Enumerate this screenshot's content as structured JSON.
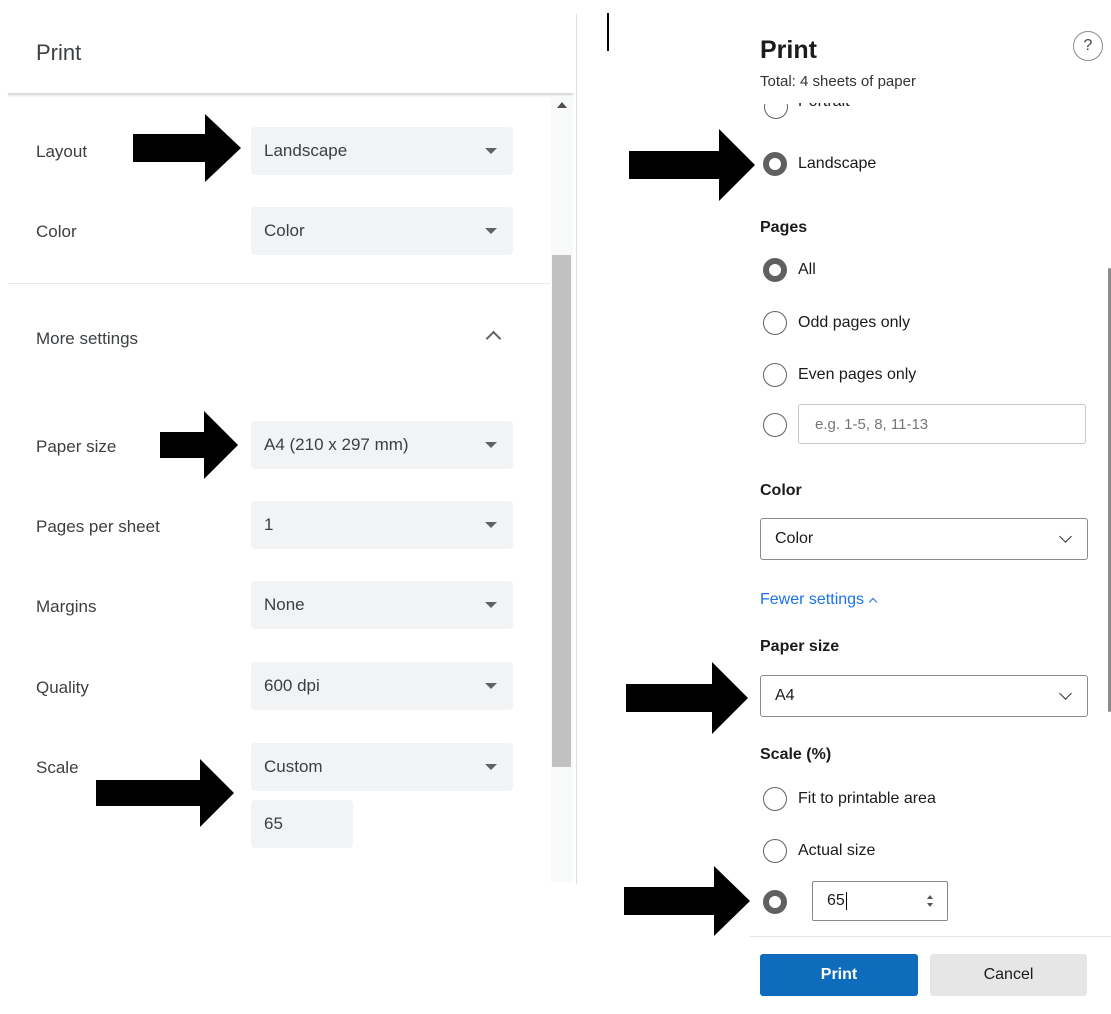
{
  "chrome_dialog": {
    "title": "Print",
    "layout": {
      "label": "Layout",
      "value": "Landscape"
    },
    "color": {
      "label": "Color",
      "value": "Color"
    },
    "more_settings": {
      "label": "More settings"
    },
    "paper_size": {
      "label": "Paper size",
      "value": "A4 (210 x 297 mm)"
    },
    "pages_per_sheet": {
      "label": "Pages per sheet",
      "value": "1"
    },
    "margins": {
      "label": "Margins",
      "value": "None"
    },
    "quality": {
      "label": "Quality",
      "value": "600 dpi"
    },
    "scale": {
      "label": "Scale",
      "value": "Custom",
      "custom_value": "65"
    }
  },
  "edge_dialog": {
    "title": "Print",
    "subtitle": "Total: 4 sheets of paper",
    "help": "?",
    "layout_options": {
      "portrait": "Portrait",
      "landscape": "Landscape",
      "selected": "landscape"
    },
    "pages": {
      "label": "Pages",
      "all": "All",
      "odd": "Odd pages only",
      "even": "Even pages only",
      "custom_placeholder": "e.g. 1-5, 8, 11-13",
      "selected": "all"
    },
    "color": {
      "label": "Color",
      "value": "Color"
    },
    "fewer_settings": "Fewer settings",
    "paper_size": {
      "label": "Paper size",
      "value": "A4"
    },
    "scale": {
      "label": "Scale (%)",
      "fit": "Fit to printable area",
      "actual": "Actual size",
      "custom_value": "65",
      "selected": "custom"
    },
    "buttons": {
      "print": "Print",
      "cancel": "Cancel"
    }
  },
  "colors": {
    "chrome_select_bg": "#f1f3f4",
    "edge_primary": "#0f6cbd",
    "edge_link": "#1a73e8",
    "arrow": "#000000"
  },
  "icons": [
    "chevron-down-icon",
    "chevron-up-icon",
    "help-icon",
    "spin-button-icon",
    "arrow-annotation"
  ]
}
